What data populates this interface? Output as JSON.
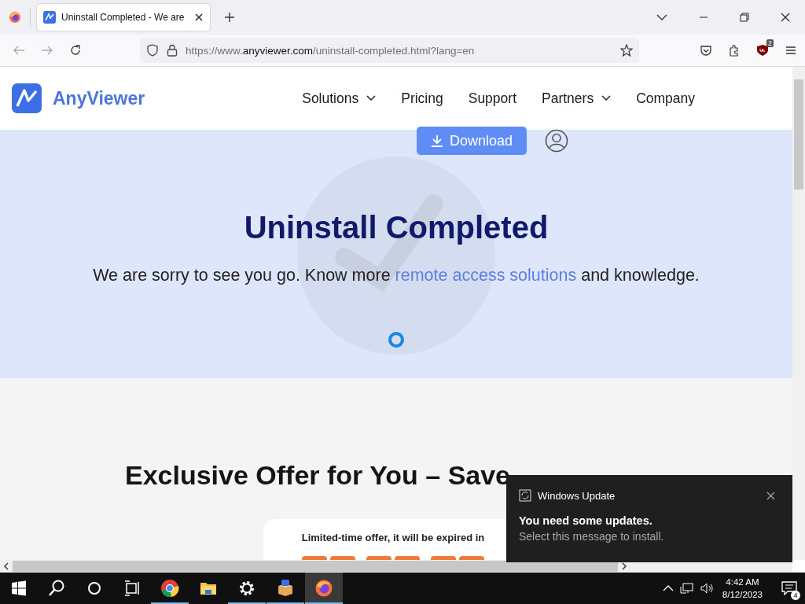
{
  "browser": {
    "tab_title": "Uninstall Completed - We are",
    "url_scheme": "https://www.",
    "url_domain": "anyviewer.com",
    "url_path": "/uninstall-completed.html?lang=en",
    "extension_badge": "2"
  },
  "site": {
    "logo": "AnyViewer",
    "nav": [
      {
        "label": "Solutions",
        "dropdown": true
      },
      {
        "label": "Pricing",
        "dropdown": false
      },
      {
        "label": "Support",
        "dropdown": false
      },
      {
        "label": "Partners",
        "dropdown": true
      },
      {
        "label": "Company",
        "dropdown": false
      }
    ],
    "download_button": "Download",
    "hero": {
      "title": "Uninstall Completed",
      "text_before": "We are sorry to see you go. Know more ",
      "link": "remote access solutions",
      "text_after": " and knowledge."
    },
    "offer": {
      "heading": "Exclusive Offer for You – Save",
      "card_text": "Limited-time offer, it will be expired in"
    }
  },
  "notification": {
    "app": "Windows Update",
    "title": "You need some updates.",
    "body": "Select this message to install."
  },
  "taskbar": {
    "apps": [
      {
        "kind": "chrome",
        "running": true,
        "active": false
      },
      {
        "kind": "folder",
        "running": false,
        "active": false
      },
      {
        "kind": "gear",
        "running": true,
        "active": false
      },
      {
        "kind": "box",
        "running": true,
        "active": false
      },
      {
        "kind": "firefox",
        "running": true,
        "active": true
      }
    ],
    "time": "4:42 AM",
    "date": "8/12/2023",
    "notification_count": "4"
  }
}
